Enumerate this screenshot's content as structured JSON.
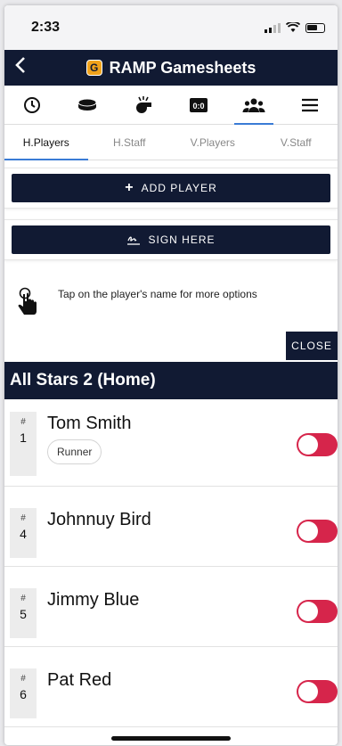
{
  "status": {
    "time": "2:33"
  },
  "app": {
    "title": "RAMP Gamesheets",
    "logo_letter": "G"
  },
  "icon_tabs": [
    "clock-icon",
    "puck-icon",
    "whistle-icon",
    "scoreboard-icon",
    "team-icon",
    "menu-icon"
  ],
  "icon_tab_active": "team-icon",
  "scoreboard_text": "0:0",
  "tabs": [
    {
      "label": "H.Players",
      "active": true
    },
    {
      "label": "H.Staff",
      "active": false
    },
    {
      "label": "V.Players",
      "active": false
    },
    {
      "label": "V.Staff",
      "active": false
    }
  ],
  "actions": {
    "add_player_icon": "+",
    "add_player_label": "ADD PLAYER",
    "sign_label": "SIGN HERE"
  },
  "hint": {
    "text": "Tap on the player's name for more options"
  },
  "close_label": "CLOSE",
  "team": {
    "name": "All Stars 2 (Home)"
  },
  "players": [
    {
      "number": "1",
      "name": "Tom Smith",
      "badge": "Runner",
      "toggle_on": false
    },
    {
      "number": "4",
      "name": "Johnnuy Bird",
      "badge": "",
      "toggle_on": false
    },
    {
      "number": "5",
      "name": "Jimmy Blue",
      "badge": "",
      "toggle_on": false
    },
    {
      "number": "6",
      "name": "Pat Red",
      "badge": "",
      "toggle_on": false
    }
  ],
  "number_prefix": "#",
  "colors": {
    "navy": "#111a33",
    "toggle": "#d6254b",
    "accent": "#3a7bd5"
  }
}
